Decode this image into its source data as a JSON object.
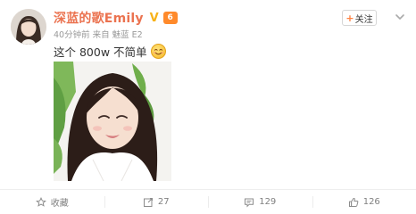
{
  "post": {
    "username": "深蓝的歌Emily",
    "vip_badge": "V",
    "medal_label": "6",
    "time": "40分钟前",
    "source_prefix": "来自",
    "source": "魅蓝 E2",
    "text": "这个 800w 不简单",
    "emoji": "smiling-face-icon"
  },
  "follow": {
    "plus": "+",
    "label": "关注"
  },
  "actions": {
    "favorite": {
      "label": "收藏",
      "icon": "star-icon"
    },
    "repost": {
      "count": "27",
      "icon": "repost-icon"
    },
    "comment": {
      "count": "129",
      "icon": "comment-icon"
    },
    "like": {
      "count": "126",
      "icon": "thumbs-up-icon"
    }
  },
  "colors": {
    "username": "#eb7350",
    "follow_plus": "#ff8140",
    "meta_text": "#999999",
    "action_text": "#808080"
  }
}
